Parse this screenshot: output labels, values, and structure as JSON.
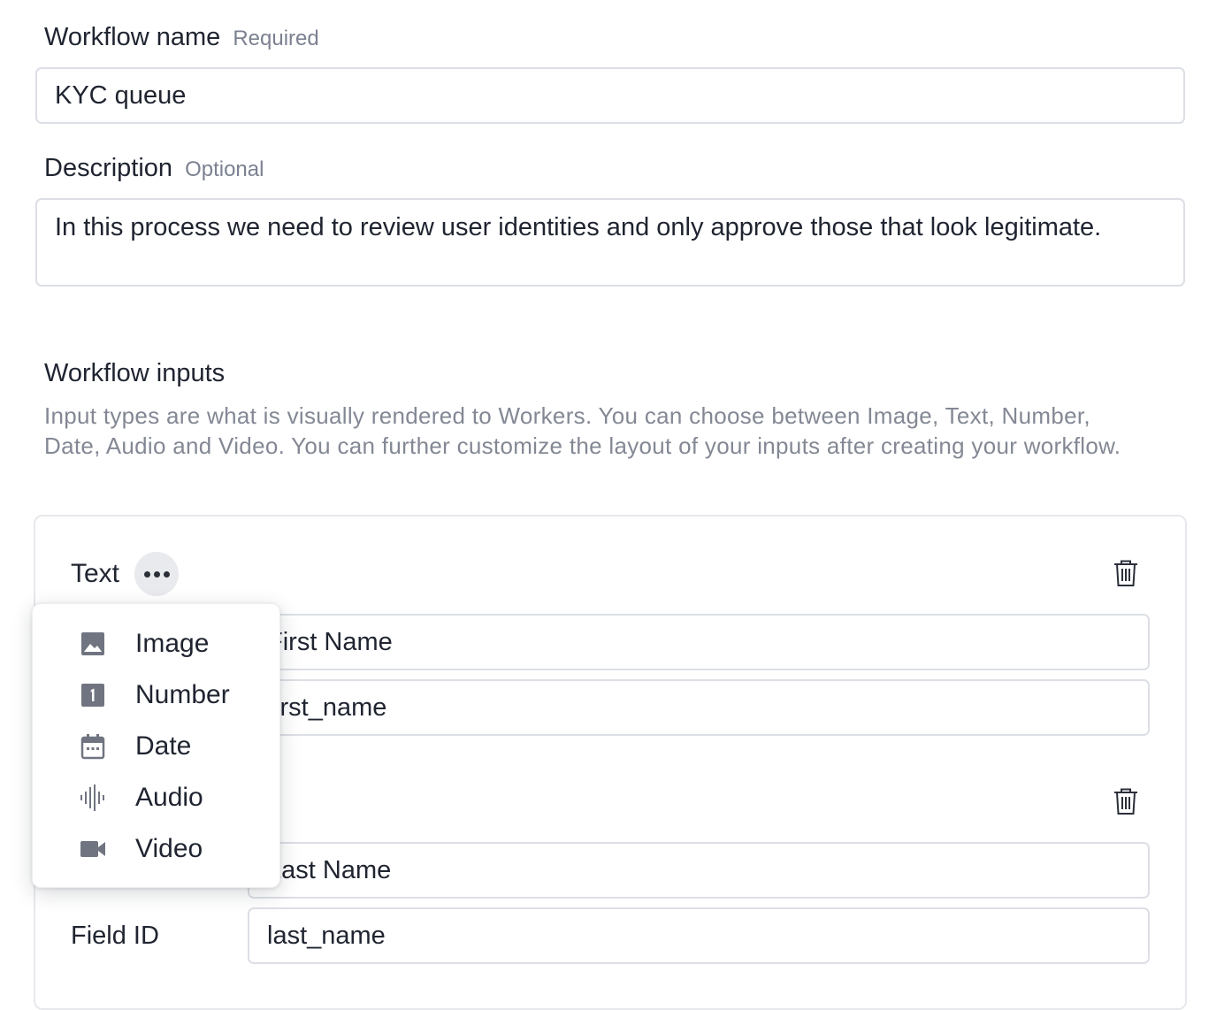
{
  "workflow_name": {
    "label": "Workflow name",
    "hint": "Required",
    "value": "KYC queue"
  },
  "description": {
    "label": "Description",
    "hint": "Optional",
    "value": "In this process we need to review user identities and only approve those that look legitimate."
  },
  "inputs_section": {
    "title": "Workflow inputs",
    "help": "Input types are what is visually rendered to Workers. You can choose between Image, Text, Number, Date, Audio and Video. You can further customize the layout of your inputs after creating your workflow."
  },
  "inputs": [
    {
      "type_label": "Text",
      "name_value": "First Name",
      "id_value": "first_name"
    },
    {
      "name_value": "Last Name",
      "id_label": "Field ID",
      "id_value": "last_name"
    }
  ],
  "type_menu": {
    "items": [
      {
        "label": "Image",
        "icon": "image-icon"
      },
      {
        "label": "Number",
        "icon": "number-icon"
      },
      {
        "label": "Date",
        "icon": "calendar-icon"
      },
      {
        "label": "Audio",
        "icon": "audio-waveform-icon"
      },
      {
        "label": "Video",
        "icon": "video-camera-icon"
      }
    ]
  },
  "colors": {
    "icon": "#6f7480",
    "border": "#dcdfe5",
    "hint": "#7b8190"
  }
}
